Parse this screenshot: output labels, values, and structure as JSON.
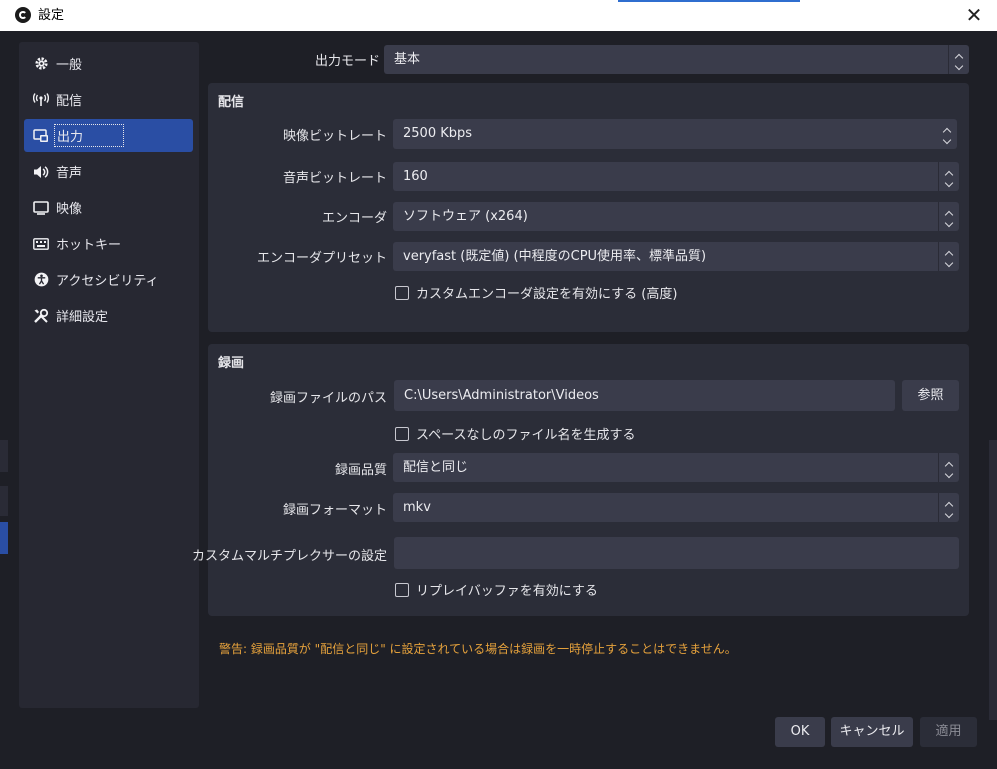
{
  "window": {
    "title": "設定",
    "close_glyph": "✕"
  },
  "sidebar": {
    "items": [
      {
        "label": "一般",
        "icon": "gear-icon",
        "active": false
      },
      {
        "label": "配信",
        "icon": "broadcast-icon",
        "active": false
      },
      {
        "label": "出力",
        "icon": "output-icon",
        "active": true
      },
      {
        "label": "音声",
        "icon": "speaker-icon",
        "active": false
      },
      {
        "label": "映像",
        "icon": "monitor-icon",
        "active": false
      },
      {
        "label": "ホットキー",
        "icon": "keyboard-icon",
        "active": false
      },
      {
        "label": "アクセシビリティ",
        "icon": "accessibility-icon",
        "active": false
      },
      {
        "label": "詳細設定",
        "icon": "tools-icon",
        "active": false
      }
    ]
  },
  "output_mode": {
    "label": "出力モード",
    "value": "基本"
  },
  "streaming": {
    "title": "配信",
    "video_bitrate": {
      "label": "映像ビットレート",
      "value": "2500 Kbps"
    },
    "audio_bitrate": {
      "label": "音声ビットレート",
      "value": "160"
    },
    "encoder": {
      "label": "エンコーダ",
      "value": "ソフトウェア (x264)"
    },
    "encoder_preset": {
      "label": "エンコーダプリセット",
      "value": "veryfast (既定値) (中程度のCPU使用率、標準品質)"
    },
    "custom_encoder": {
      "label": "カスタムエンコーダ設定を有効にする (高度)",
      "checked": false
    }
  },
  "recording": {
    "title": "録画",
    "path": {
      "label": "録画ファイルのパス",
      "value": "C:\\Users\\Administrator\\Videos"
    },
    "browse_label": "参照",
    "no_space": {
      "label": "スペースなしのファイル名を生成する",
      "checked": false
    },
    "quality": {
      "label": "録画品質",
      "value": "配信と同じ"
    },
    "format": {
      "label": "録画フォーマット",
      "value": "mkv"
    },
    "muxer": {
      "label": "カスタムマルチプレクサーの設定",
      "value": ""
    },
    "replay_buffer": {
      "label": "リプレイバッファを有効にする",
      "checked": false
    }
  },
  "warning": "警告: 録画品質が \"配信と同じ\" に設定されている場合は録画を一時停止することはできません。",
  "buttons": {
    "ok": "OK",
    "cancel": "キャンセル",
    "apply": "適用"
  },
  "colors": {
    "accent": "#2a4ea4",
    "warning": "#e6a23c",
    "background": "#1e1f26"
  }
}
